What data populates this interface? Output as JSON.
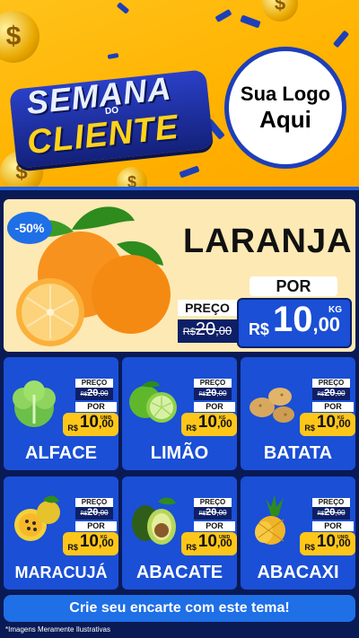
{
  "header": {
    "headline_line1": "SEMANA",
    "headline_connector": "DO",
    "headline_line2": "CLIENTE",
    "logo_line1": "Sua Logo",
    "logo_line2": "Aqui",
    "coin_symbol": "$"
  },
  "featured": {
    "discount": "-50%",
    "name": "LARANJA",
    "price_label": "PREÇO",
    "old_currency": "R$",
    "old_int": "20",
    "old_dec": ",00",
    "por_label": "POR",
    "new_currency": "R$",
    "new_int": "10",
    "new_dec": ",00",
    "unit": "KG",
    "icon": "orange-icon"
  },
  "products": [
    {
      "name": "ALFACE",
      "price_label": "PREÇO",
      "old_currency": "R$",
      "old_int": "20",
      "old_dec": ",00",
      "por_label": "POR",
      "new_currency": "R$",
      "new_int": "10",
      "new_dec": ",00",
      "unit": "UNID",
      "icon": "lettuce-icon"
    },
    {
      "name": "LIMÃO",
      "price_label": "PREÇO",
      "old_currency": "R$",
      "old_int": "20",
      "old_dec": ",00",
      "por_label": "POR",
      "new_currency": "R$",
      "new_int": "10",
      "new_dec": ",00",
      "unit": "KG",
      "icon": "lime-icon"
    },
    {
      "name": "BATATA",
      "price_label": "PREÇO",
      "old_currency": "R$",
      "old_int": "20",
      "old_dec": ",00",
      "por_label": "POR",
      "new_currency": "R$",
      "new_int": "10",
      "new_dec": ",00",
      "unit": "KG",
      "icon": "potato-icon"
    },
    {
      "name": "MARACUJÁ",
      "price_label": "PREÇO",
      "old_currency": "R$",
      "old_int": "20",
      "old_dec": ",00",
      "por_label": "POR",
      "new_currency": "R$",
      "new_int": "10",
      "new_dec": ",00",
      "unit": "KG",
      "icon": "passion-fruit-icon"
    },
    {
      "name": "ABACATE",
      "price_label": "PREÇO",
      "old_currency": "R$",
      "old_int": "20",
      "old_dec": ",00",
      "por_label": "POR",
      "new_currency": "R$",
      "new_int": "10",
      "new_dec": ",00",
      "unit": "UNID",
      "icon": "avocado-icon"
    },
    {
      "name": "ABACAXI",
      "price_label": "PREÇO",
      "old_currency": "R$",
      "old_int": "20",
      "old_dec": ",00",
      "por_label": "POR",
      "new_currency": "R$",
      "new_int": "10",
      "new_dec": ",00",
      "unit": "UNID",
      "icon": "pineapple-icon"
    }
  ],
  "footer": {
    "cta": "Crie seu encarte com este tema!",
    "disclaimer": "*Imagens Meramente Ilustrativas"
  },
  "colors": {
    "header_yellow": "#ffb300",
    "brand_blue": "#1a4fd6",
    "navy": "#0d1f66",
    "price_yellow": "#ffc61a"
  }
}
